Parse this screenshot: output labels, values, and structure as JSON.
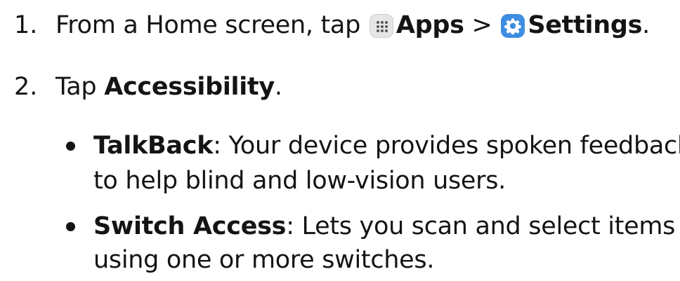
{
  "steps": [
    {
      "number": "1.",
      "text_before": "From a Home screen, tap ",
      "apps_label": "Apps",
      "separator": " > ",
      "settings_label": "Settings",
      "period": "."
    },
    {
      "number": "2.",
      "text_before": "Tap ",
      "accessibility_label": "Accessibility",
      "period": "."
    }
  ],
  "bullets": [
    {
      "term": "TalkBack",
      "line1": ": Your device provides spoken feedback",
      "line2": "to help blind and low-vision users."
    },
    {
      "term": "Switch Access",
      "line1": ": Lets you scan and select items",
      "line2": "using one or more switches."
    }
  ],
  "icons": {
    "apps": "apps-grid-icon",
    "settings": "gear-icon",
    "settings_color": "#3f8de2"
  }
}
